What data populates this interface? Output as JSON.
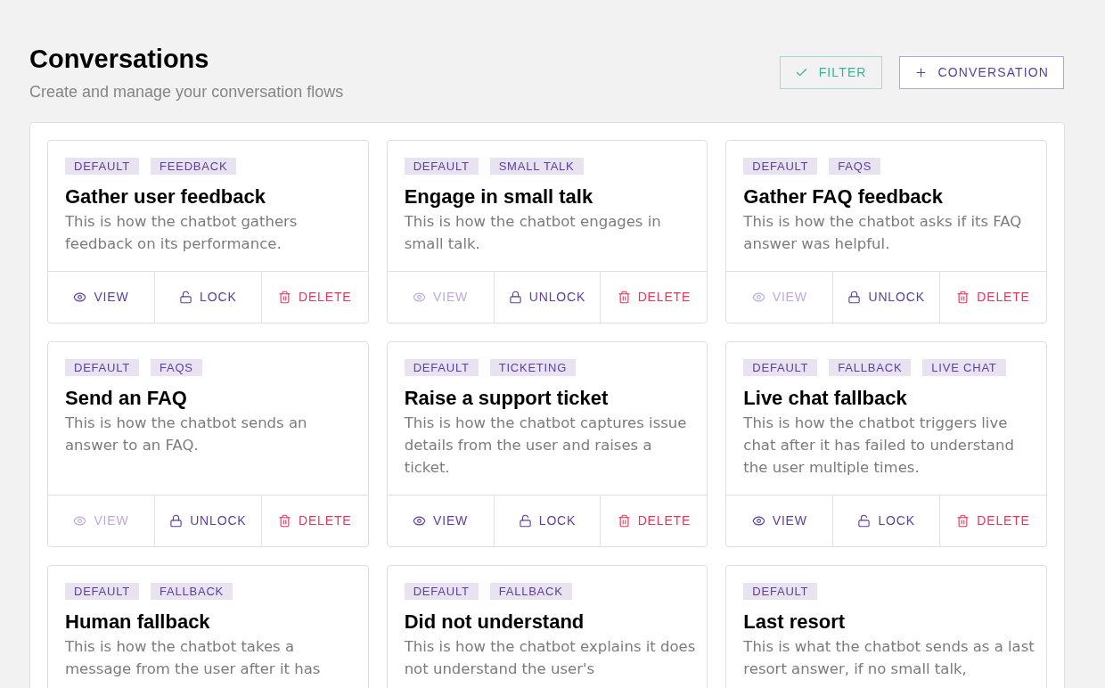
{
  "header": {
    "title": "Conversations",
    "subtitle": "Create and manage your conversation flows"
  },
  "buttons": [
    {
      "kind": "filter",
      "label": "FILTER"
    },
    {
      "kind": "add",
      "label": "CONVERSATION"
    }
  ],
  "cards": [
    {
      "tags": [
        "DEFAULT",
        "FEEDBACK"
      ],
      "title": "Gather user feedback",
      "description": "This is how the chatbot gathers feedback on its performance.",
      "actions": [
        {
          "kind": "view",
          "label": "VIEW",
          "disabled": false
        },
        {
          "kind": "lock",
          "label": "LOCK"
        },
        {
          "kind": "delete",
          "label": "DELETE"
        }
      ]
    },
    {
      "tags": [
        "DEFAULT",
        "SMALL TALK"
      ],
      "title": "Engage in small talk",
      "description": "This is how the chatbot engages in small talk.",
      "actions": [
        {
          "kind": "view",
          "label": "VIEW",
          "disabled": true
        },
        {
          "kind": "unlock",
          "label": "UNLOCK"
        },
        {
          "kind": "delete",
          "label": "DELETE"
        }
      ]
    },
    {
      "tags": [
        "DEFAULT",
        "FAQS"
      ],
      "title": "Gather FAQ feedback",
      "description": "This is how the chatbot asks if its FAQ answer was helpful.",
      "actions": [
        {
          "kind": "view",
          "label": "VIEW",
          "disabled": true
        },
        {
          "kind": "unlock",
          "label": "UNLOCK"
        },
        {
          "kind": "delete",
          "label": "DELETE"
        }
      ]
    },
    {
      "tags": [
        "DEFAULT",
        "FAQS"
      ],
      "title": "Send an FAQ",
      "description": "This is how the chatbot sends an answer to an FAQ.",
      "actions": [
        {
          "kind": "view",
          "label": "VIEW",
          "disabled": true
        },
        {
          "kind": "unlock",
          "label": "UNLOCK"
        },
        {
          "kind": "delete",
          "label": "DELETE"
        }
      ]
    },
    {
      "tags": [
        "DEFAULT",
        "TICKETING"
      ],
      "title": "Raise a support ticket",
      "description": "This is how the chatbot captures issue details from the user and raises a ticket.",
      "actions": [
        {
          "kind": "view",
          "label": "VIEW",
          "disabled": false
        },
        {
          "kind": "lock",
          "label": "LOCK"
        },
        {
          "kind": "delete",
          "label": "DELETE"
        }
      ]
    },
    {
      "tags": [
        "DEFAULT",
        "FALLBACK",
        "LIVE CHAT"
      ],
      "title": "Live chat fallback",
      "description": "This is how the chatbot triggers live chat after it has failed to understand the user multiple times.",
      "actions": [
        {
          "kind": "view",
          "label": "VIEW",
          "disabled": false
        },
        {
          "kind": "lock",
          "label": "LOCK"
        },
        {
          "kind": "delete",
          "label": "DELETE"
        }
      ]
    },
    {
      "tags": [
        "DEFAULT",
        "FALLBACK"
      ],
      "title": "Human fallback",
      "description": "This is how the chatbot takes a message from the user after it has"
    },
    {
      "tags": [
        "DEFAULT",
        "FALLBACK"
      ],
      "title": "Did not understand",
      "description": "This is how the chatbot explains it does not understand the user's"
    },
    {
      "tags": [
        "DEFAULT"
      ],
      "title": "Last resort",
      "description": "This is what the chatbot sends as a last resort answer, if no small talk,"
    }
  ]
}
